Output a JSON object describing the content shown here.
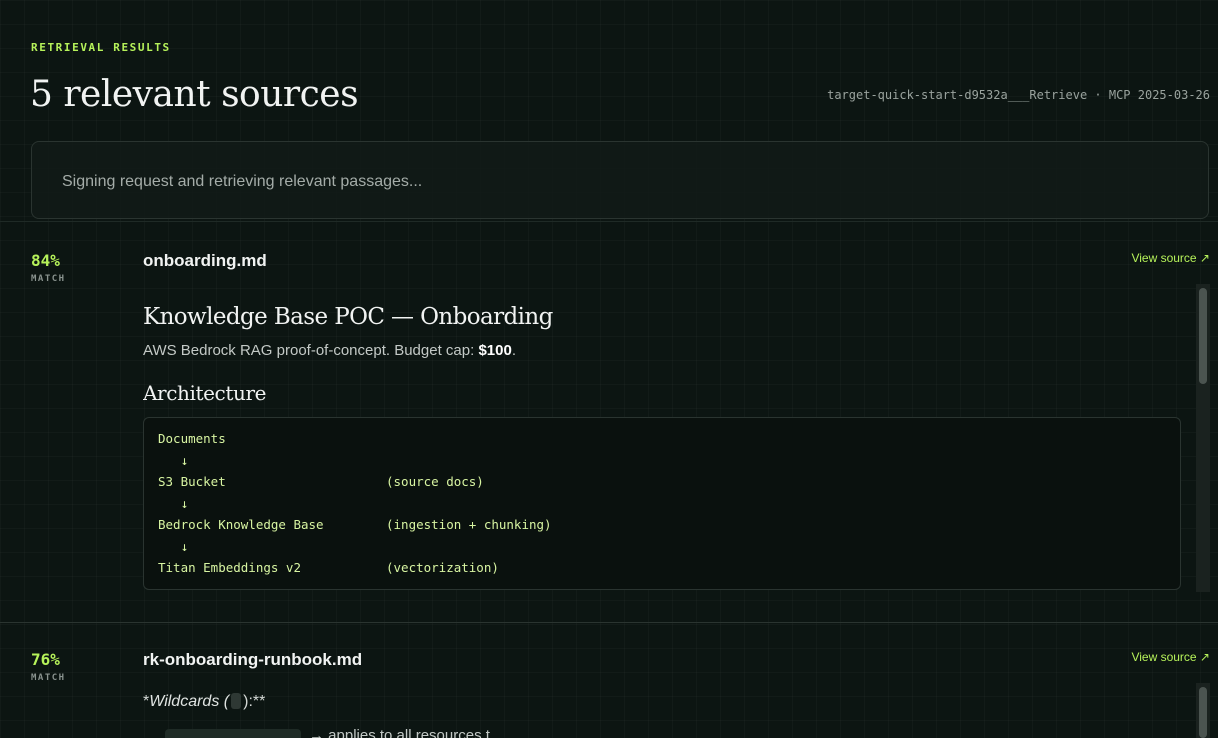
{
  "header": {
    "eyebrow": "RETRIEVAL RESULTS",
    "title": "5 relevant sources",
    "meta": "target-quick-start-d9532a___Retrieve · MCP 2025-03-26"
  },
  "status": {
    "text": "Signing request and retrieving relevant passages..."
  },
  "results": [
    {
      "score": "84%",
      "score_label": "MATCH",
      "filename": "onboarding.md",
      "view_label": "View source ↗",
      "doc": {
        "h1": "Knowledge Base POC — Onboarding",
        "p_prefix": "AWS Bedrock RAG proof-of-concept. Budget cap: ",
        "p_bold": "$100",
        "p_suffix": ".",
        "h2": "Architecture",
        "code": [
          {
            "left": "Documents",
            "right": ""
          },
          {
            "left": "   ↓",
            "right": ""
          },
          {
            "left": "S3 Bucket",
            "right": "(source docs)"
          },
          {
            "left": "   ↓",
            "right": ""
          },
          {
            "left": "Bedrock Knowledge Base",
            "right": "(ingestion + chunking)"
          },
          {
            "left": "   ↓",
            "right": ""
          },
          {
            "left": "Titan Embeddings v2",
            "right": "(vectorization)"
          }
        ]
      }
    },
    {
      "score": "76%",
      "score_label": "MATCH",
      "filename": "rk-onboarding-runbook.md",
      "view_label": "View source ↗",
      "doc": {
        "wild_prefix": "*",
        "wild_italic": "Wildcards (",
        "wild_suffix": "):**",
        "cut_text": "→ applies to all resources t"
      }
    }
  ]
}
